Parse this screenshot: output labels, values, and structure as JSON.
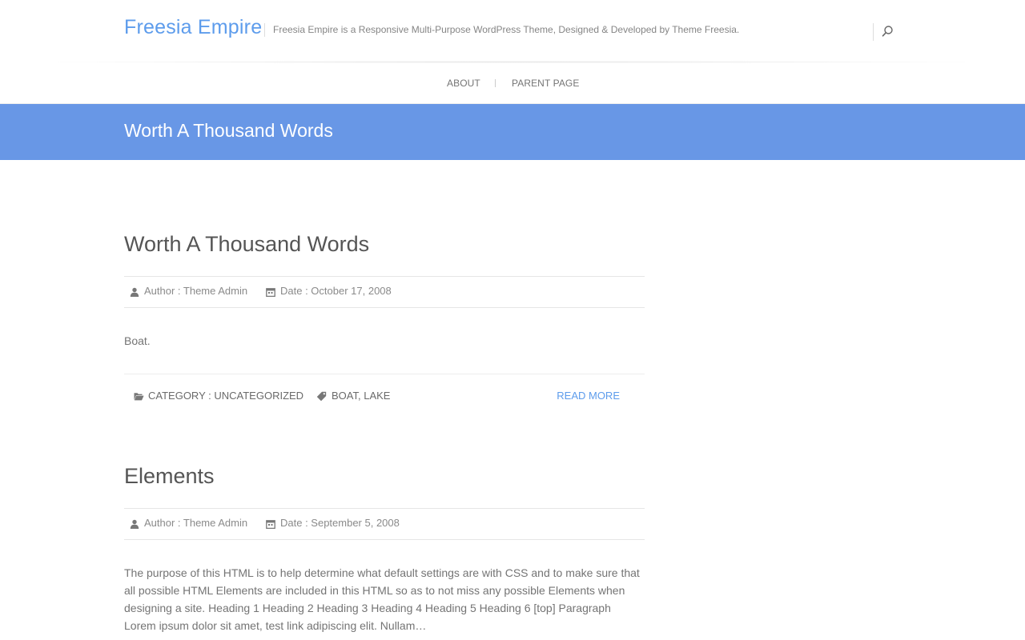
{
  "header": {
    "site_title": "Freesia Empire",
    "site_description": "Freesia Empire is a Responsive Multi-Purpose WordPress Theme, Designed & Developed by Theme Freesia.",
    "search_icon": "search-icon"
  },
  "nav": {
    "items": [
      {
        "label": "ABOUT"
      },
      {
        "label": "PARENT PAGE"
      }
    ]
  },
  "page": {
    "title": "Worth A Thousand Words"
  },
  "posts": [
    {
      "title": "Worth A Thousand Words",
      "author_label": "Author : ",
      "author": "Theme Admin",
      "date_label": "Date : ",
      "date": "October 17, 2008",
      "excerpt": "Boat.",
      "category_label": "CATEGORY : ",
      "category": "UNCATEGORIZED",
      "tags": [
        "BOAT",
        "LAKE"
      ],
      "tag_sep": ", ",
      "read_more": "READ MORE"
    },
    {
      "title": "Elements",
      "author_label": "Author : ",
      "author": "Theme Admin",
      "date_label": "Date : ",
      "date": "September 5, 2008",
      "excerpt": "The purpose of this HTML is to help determine what default settings are with CSS and to make sure that all possible HTML Elements are included in this HTML so as to not miss any possible Elements when designing a site. Heading 1 Heading 2 Heading 3 Heading 4 Heading 5 Heading 6 [top] Paragraph Lorem ipsum dolor sit amet, test link adipiscing elit. Nullam…"
    }
  ],
  "colors": {
    "accent": "#5d9cec",
    "banner": "#6897e6",
    "text": "#747474"
  }
}
